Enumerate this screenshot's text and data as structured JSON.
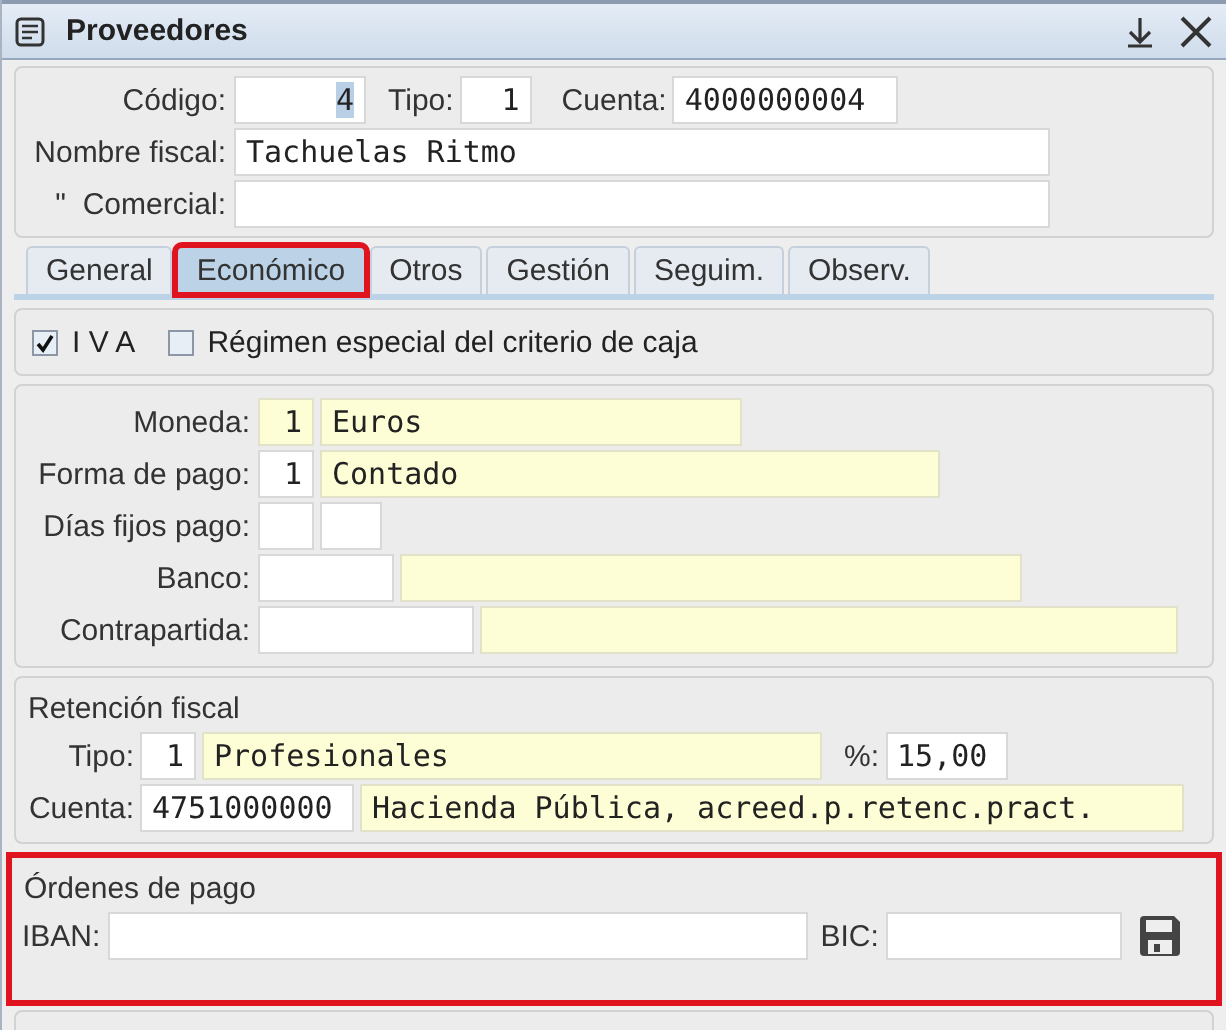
{
  "window": {
    "title": "Proveedores"
  },
  "header": {
    "codigo": {
      "label": "Código:",
      "value": "4"
    },
    "tipo": {
      "label": "Tipo:",
      "value": "1"
    },
    "cuenta": {
      "label": "Cuenta:",
      "value": "4000000004"
    },
    "nombre_fiscal": {
      "label": "Nombre fiscal:",
      "value": "Tachuelas Ritmo"
    },
    "comercial": {
      "label": "\"  Comercial:"
    }
  },
  "tabs": [
    {
      "label": "General",
      "selected": false,
      "highlighted": false
    },
    {
      "label": "Económico",
      "selected": true,
      "highlighted": true
    },
    {
      "label": "Otros",
      "selected": false,
      "highlighted": false
    },
    {
      "label": "Gestión",
      "selected": false,
      "highlighted": false
    },
    {
      "label": "Seguim.",
      "selected": false,
      "highlighted": false
    },
    {
      "label": "Observ.",
      "selected": false,
      "highlighted": false
    }
  ],
  "checkboxes": [
    {
      "label": "I V A",
      "checked": true
    },
    {
      "label": "Régimen especial del criterio de caja",
      "checked": false
    }
  ],
  "payment_rows": [
    {
      "label": "Moneda:",
      "fields": [
        {
          "value": "1",
          "readonly": true
        },
        {
          "value": "Euros",
          "readonly": true
        }
      ]
    },
    {
      "label": "Forma de pago:",
      "fields": [
        {
          "value": "1",
          "readonly": false
        },
        {
          "value": "Contado",
          "readonly": true
        }
      ]
    },
    {
      "label": "Días fijos pago:",
      "fields": [
        {
          "readonly": false
        },
        {
          "readonly": false
        }
      ]
    },
    {
      "label": "Banco:",
      "fields": [
        {
          "readonly": false
        },
        {
          "readonly": true
        }
      ]
    },
    {
      "label": "Contrapartida:",
      "fields": [
        {
          "readonly": false
        },
        {
          "readonly": true
        }
      ]
    }
  ],
  "retencion": {
    "title": "Retención fiscal",
    "tipo": {
      "label": "Tipo:",
      "code": "1",
      "description": "Profesionales"
    },
    "percent": {
      "label": "%:",
      "value": "15,00"
    },
    "cuenta": {
      "label": "Cuenta:",
      "code": "4751000000",
      "description": "Hacienda Pública, acreed.p.retenc.pract."
    }
  },
  "ordenes": {
    "title": "Órdenes de pago",
    "highlighted": true,
    "iban": {
      "label": "IBAN:"
    },
    "bic": {
      "label": "BIC:"
    }
  }
}
